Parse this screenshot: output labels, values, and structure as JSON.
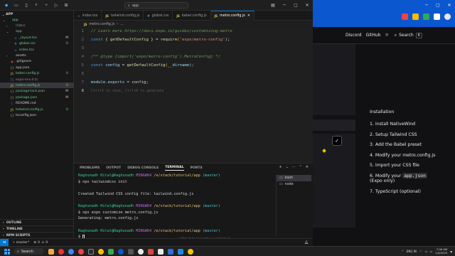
{
  "vscode": {
    "title_search": "app",
    "explorer": {
      "root_label": "APP",
      "rows": [
        {
          "label": "app",
          "icon": "folder",
          "indent": 0,
          "type": "folder-open",
          "color": "green",
          "badge": ""
        },
        {
          "label": "(tabs)",
          "icon": "folder",
          "indent": 1,
          "type": "folder",
          "color": "gray",
          "badge": ""
        },
        {
          "label": "app",
          "icon": "folder",
          "indent": 1,
          "type": "folder-open",
          "color": "green",
          "badge": ""
        },
        {
          "label": "_layout.tsx",
          "icon": "tsx",
          "indent": 2,
          "type": "file",
          "color": "green",
          "badge": "M"
        },
        {
          "label": "global.css",
          "icon": "css",
          "indent": 2,
          "type": "file",
          "color": "green",
          "badge": "U"
        },
        {
          "label": "index.tsx",
          "icon": "tsx",
          "indent": 2,
          "type": "file",
          "color": "green",
          "badge": ""
        },
        {
          "label": "assets",
          "icon": "folder",
          "indent": 1,
          "type": "folder",
          "color": "white",
          "badge": ""
        },
        {
          "label": ".gitignore",
          "icon": "git",
          "indent": 1,
          "type": "file",
          "color": "white",
          "badge": ""
        },
        {
          "label": "app.json",
          "icon": "json",
          "indent": 1,
          "type": "file",
          "color": "white",
          "badge": ""
        },
        {
          "label": "babel.config.js",
          "icon": "js",
          "indent": 1,
          "type": "file",
          "color": "green",
          "badge": "U"
        },
        {
          "label": "expo-env.d.ts",
          "icon": "ts",
          "indent": 1,
          "type": "file",
          "color": "gray",
          "badge": ""
        },
        {
          "label": "metro.config.js",
          "icon": "js",
          "indent": 1,
          "type": "file",
          "color": "green",
          "badge": "U"
        },
        {
          "label": "package-lock.json",
          "icon": "json",
          "indent": 1,
          "type": "file",
          "color": "green",
          "badge": "M"
        },
        {
          "label": "package.json",
          "icon": "json",
          "indent": 1,
          "type": "file",
          "color": "green",
          "badge": "M"
        },
        {
          "label": "README.md",
          "icon": "md",
          "indent": 1,
          "type": "file",
          "color": "white",
          "badge": ""
        },
        {
          "label": "tailwind.config.js",
          "icon": "js",
          "indent": 1,
          "type": "file",
          "color": "green",
          "badge": "U"
        },
        {
          "label": "tsconfig.json",
          "icon": "json",
          "indent": 1,
          "type": "file",
          "color": "white",
          "badge": ""
        }
      ],
      "selected_index": 11,
      "sections": [
        "OUTLINE",
        "TIMELINE",
        "NPM SCRIPTS"
      ]
    },
    "tabs": [
      {
        "label": "index.tsx",
        "icon": "tsx",
        "active": false
      },
      {
        "label": "tailwind.config.js",
        "icon": "js",
        "active": false
      },
      {
        "label": "global.css",
        "icon": "css",
        "active": false
      },
      {
        "label": "babel.config.js",
        "icon": "js",
        "active": false
      },
      {
        "label": "metro.config.js",
        "icon": "js",
        "active": true
      }
    ],
    "breadcrumb": [
      "metro.config.js",
      "..."
    ],
    "code": {
      "line1_comment": "// Learn more https://docs.expo.io/guides/customizing-metro",
      "line2_kw": "const",
      "line2_destructure": "{ getDefaultConfig }",
      "line2_eq": " = ",
      "line2_fn": "require",
      "line2_arg": "'expo/metro-config'",
      "line2_end": ");",
      "line4_comment": "/** @type {import('expo/metro-config').MetroConfig} */",
      "line5_kw": "const",
      "line5_var": " config ",
      "line5_eq": "= ",
      "line5_fn": "getDefaultConfig",
      "line5_arg": "__dirname",
      "line5_end": ");",
      "line7_a": "module",
      "line7_b": ".exports",
      "line7_c": " = config;",
      "line8_ghost": "Ctrl+I to chat, Ctrl+K to generate",
      "line_numbers": [
        "1",
        "2",
        "3",
        "4",
        "5",
        "6",
        "7",
        "8"
      ]
    },
    "panel": {
      "tabs": [
        "PROBLEMS",
        "OUTPUT",
        "DEBUG CONSOLE",
        "TERMINAL",
        "PORTS"
      ],
      "active_tab": "TERMINAL",
      "terminal": {
        "prompt_user": "Raghunadh Hital@Raghunadh",
        "prompt_host": "MINGW64",
        "prompt_path": "/e/stack/tutorial/app",
        "prompt_branch": "(master)",
        "cmd1": "$ npx tailwindcss init",
        "out1": "Created Tailwind CSS config file: tailwind.config.js",
        "cmd2": "$ npx expo customize metro.config.js",
        "out2": "Generating: metro.config.js",
        "cmd3": "$"
      },
      "terminals": [
        "bash",
        "node"
      ],
      "hint": "Ctrl+K to generate a command"
    },
    "statusbar": {
      "branch": "master*",
      "errors": "0",
      "warnings": "0"
    }
  },
  "browser": {
    "nav": {
      "discord": "Discord",
      "github": "GitHub",
      "search": "Search",
      "search_key": "K"
    },
    "toc_title": "Installation",
    "toc": [
      {
        "pre": "1. Install NativeWind",
        "code": "",
        "post": ""
      },
      {
        "pre": "2. Setup Tailwind CSS",
        "code": "",
        "post": ""
      },
      {
        "pre": "3. Add the Babel preset",
        "code": "",
        "post": ""
      },
      {
        "pre": "4. Modify your metro.config.js",
        "code": "",
        "post": ""
      },
      {
        "pre": "5. Import your CSS file",
        "code": "",
        "post": ""
      },
      {
        "pre": "6. Modify your ",
        "code": "app.json",
        "post": "(Expo only)"
      },
      {
        "pre": "7. TypeScript (optional)",
        "code": "",
        "post": ""
      }
    ]
  },
  "taskbar": {
    "search": "Search",
    "lang": "ENG IN",
    "time": "7:06 AM",
    "date": "1/4/2025"
  }
}
